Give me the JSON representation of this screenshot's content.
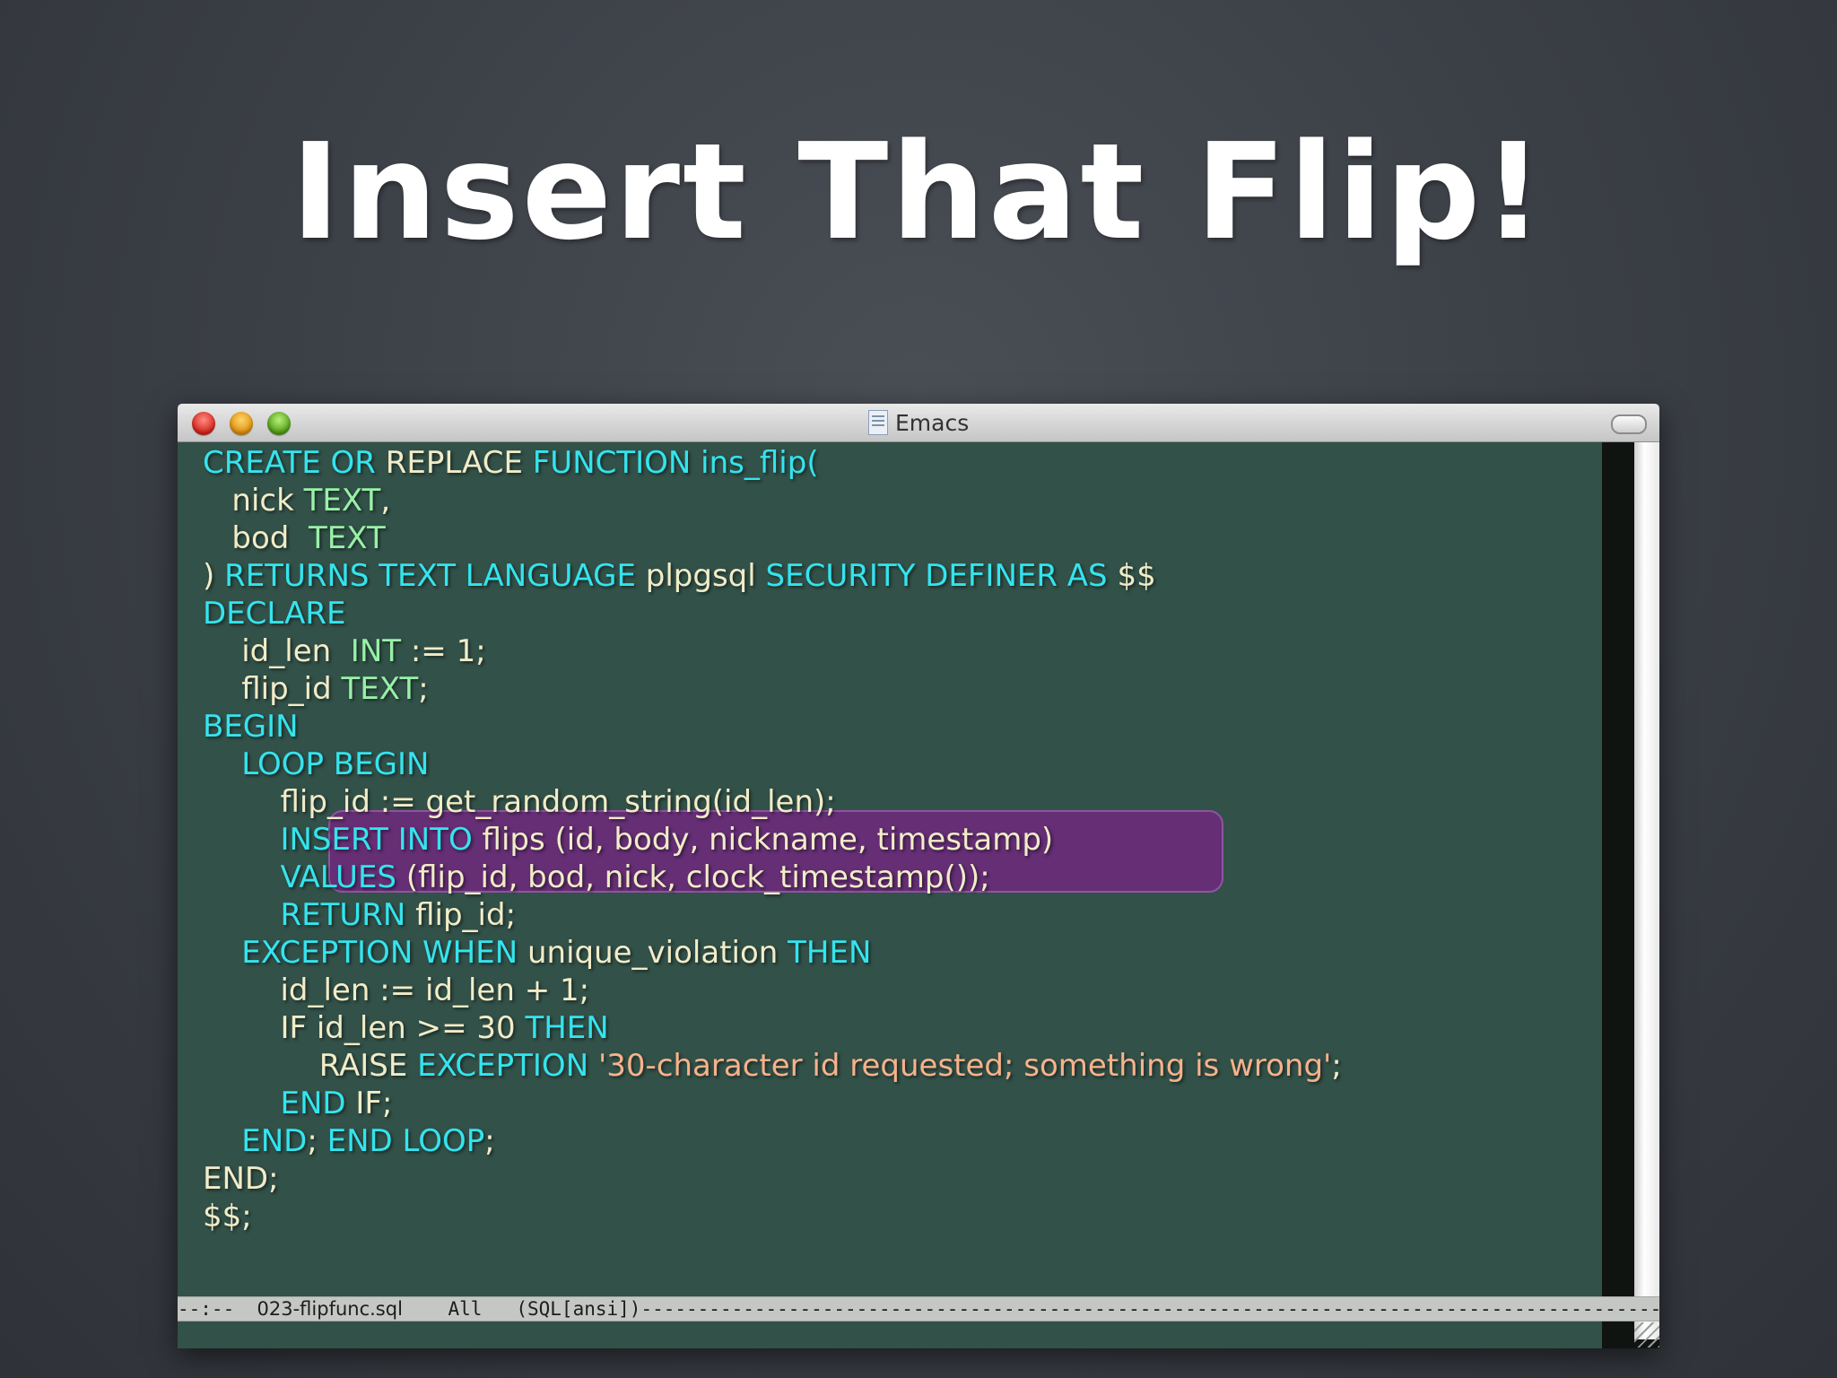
{
  "slide": {
    "title": "Insert That Flip!"
  },
  "window": {
    "title": "Emacs"
  },
  "editor": {
    "lines": [
      [
        [
          "CREATE OR ",
          "kw"
        ],
        [
          "REPLACE ",
          ""
        ],
        [
          "FUNCTION ins_flip(",
          "kw"
        ]
      ],
      [
        [
          "   nick ",
          ""
        ],
        [
          "TEXT",
          "ty"
        ],
        [
          ",",
          ""
        ]
      ],
      [
        [
          "   bod  ",
          ""
        ],
        [
          "TEXT",
          "ty"
        ]
      ],
      [
        [
          ") ",
          ""
        ],
        [
          "RETURNS TEXT LANGUAGE ",
          "kw"
        ],
        [
          "plpgsql ",
          ""
        ],
        [
          "SECURITY DEFINER AS ",
          "kw"
        ],
        [
          "$$",
          ""
        ]
      ],
      [
        [
          "DECLARE",
          "kw"
        ]
      ],
      [
        [
          "    id_len  ",
          ""
        ],
        [
          "INT",
          "ty"
        ],
        [
          " := 1;",
          ""
        ]
      ],
      [
        [
          "    flip_id ",
          ""
        ],
        [
          "TEXT",
          "ty"
        ],
        [
          ";",
          ""
        ]
      ],
      [
        [
          "BEGIN",
          "kw"
        ]
      ],
      [
        [
          "    ",
          ""
        ],
        [
          "LOOP BEGIN",
          "kw"
        ]
      ],
      [
        [
          "        flip_id := get_random_string(id_len);",
          ""
        ]
      ],
      [
        [
          "        ",
          ""
        ],
        [
          "INSERT INTO ",
          "kw"
        ],
        [
          "flips (id, body, nickname, timestamp)",
          ""
        ]
      ],
      [
        [
          "        ",
          ""
        ],
        [
          "VALUES ",
          "kw"
        ],
        [
          "(flip_id, bod, nick, clock_timestamp());",
          ""
        ]
      ],
      [
        [
          "        ",
          ""
        ],
        [
          "RETURN ",
          "kw"
        ],
        [
          "flip_id;",
          ""
        ]
      ],
      [
        [
          "    ",
          ""
        ],
        [
          "EXCEPTION WHEN ",
          "kw"
        ],
        [
          "unique_violation ",
          ""
        ],
        [
          "THEN",
          "kw"
        ]
      ],
      [
        [
          "        id_len := id_len + 1;",
          ""
        ]
      ],
      [
        [
          "        IF id_len >= 30 ",
          ""
        ],
        [
          "THEN",
          "kw"
        ]
      ],
      [
        [
          "            RAISE ",
          ""
        ],
        [
          "EXCEPTION ",
          "kw"
        ],
        [
          "'30-character id requested; something is wrong'",
          "str"
        ],
        [
          ";",
          ""
        ]
      ],
      [
        [
          "        ",
          ""
        ],
        [
          "END ",
          "kw"
        ],
        [
          "IF;",
          ""
        ]
      ],
      [
        [
          "    ",
          ""
        ],
        [
          "END",
          "kw"
        ],
        [
          "; ",
          ""
        ],
        [
          "END LOOP",
          "kw"
        ],
        [
          ";",
          ""
        ]
      ],
      [
        [
          "END;",
          ""
        ]
      ],
      [
        [
          "$$;",
          ""
        ]
      ]
    ]
  },
  "modeline": {
    "prefix": "--:--  ",
    "filename": "023-flipfunc.sql",
    "position": "    All   ",
    "mode": "(SQL[ansi])",
    "fill": "------------------------------------------------------------------------------------------------------------"
  },
  "colors": {
    "editor_background": "#325149",
    "keyword": "#34e4ee",
    "type": "#98f1a6",
    "string": "#f7b28a",
    "default_text": "#f1ecc8",
    "highlight": "#6e287d"
  },
  "icons": [
    "close-button-icon",
    "minimize-button-icon",
    "zoom-button-icon",
    "document-icon",
    "toolbar-toggle-icon",
    "resize-grip-icon"
  ]
}
